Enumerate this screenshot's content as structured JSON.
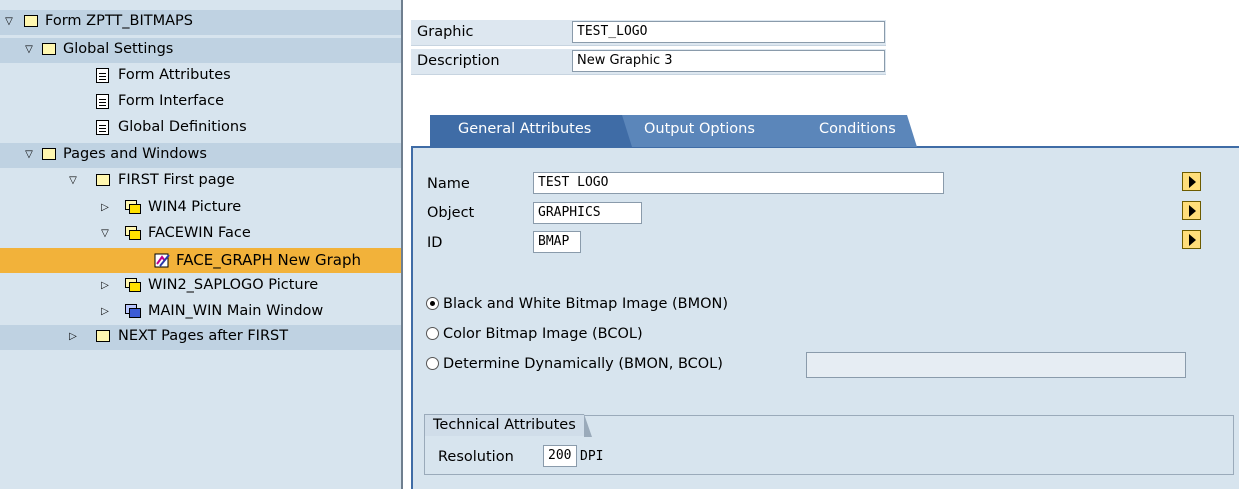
{
  "tree": {
    "items": [
      {
        "label": "Form ZPTT_BITMAPS",
        "icon": "folder-icon",
        "expander": "expanded"
      },
      {
        "label": "Global Settings",
        "icon": "folder-icon",
        "expander": "expanded"
      },
      {
        "label": "Form Attributes",
        "icon": "document-icon",
        "expander": "none"
      },
      {
        "label": "Form Interface",
        "icon": "document-icon",
        "expander": "none"
      },
      {
        "label": "Global Definitions",
        "icon": "document-icon",
        "expander": "none"
      },
      {
        "label": "Pages and Windows",
        "icon": "folder-icon",
        "expander": "expanded"
      },
      {
        "label": "FIRST First page",
        "icon": "folder-icon",
        "expander": "expanded"
      },
      {
        "label": "WIN4 Picture",
        "icon": "window-icon",
        "expander": "collapsed"
      },
      {
        "label": "FACEWIN Face",
        "icon": "window-icon",
        "expander": "expanded"
      },
      {
        "label": "FACE_GRAPH New Graph",
        "icon": "graphic-node-icon",
        "expander": "none"
      },
      {
        "label": "WIN2_SAPLOGO Picture",
        "icon": "window-icon",
        "expander": "collapsed"
      },
      {
        "label": "MAIN_WIN Main Window",
        "icon": "main-window-icon",
        "expander": "collapsed"
      },
      {
        "label": "NEXT Pages after FIRST",
        "icon": "folder-icon",
        "expander": "collapsed"
      }
    ]
  },
  "header": {
    "graphic_label": "Graphic",
    "graphic_value": "TEST_LOGO",
    "description_label": "Description",
    "description_value": "New Graphic 3"
  },
  "tabs": [
    {
      "label": "General Attributes",
      "active": true
    },
    {
      "label": "Output Options",
      "active": false
    },
    {
      "label": "Conditions",
      "active": false
    }
  ],
  "general": {
    "name_label": "Name",
    "name_value": "TEST LOGO",
    "object_label": "Object",
    "object_value": "GRAPHICS",
    "id_label": "ID",
    "id_value": "BMAP",
    "radio1": "Black and White Bitmap Image (BMON)",
    "radio2": "Color Bitmap Image (BCOL)",
    "radio3": "Determine Dynamically (BMON, BCOL)",
    "dynamic_value": ""
  },
  "technical": {
    "title": "Technical Attributes",
    "resolution_label": "Resolution",
    "resolution_value": "200",
    "unit": "DPI"
  },
  "colors": {
    "tree_bg": "#d7e4ee",
    "selected_bg": "#f2b23a",
    "tab_active": "#3f6ca6",
    "tab_inactive": "#5b86ba"
  }
}
